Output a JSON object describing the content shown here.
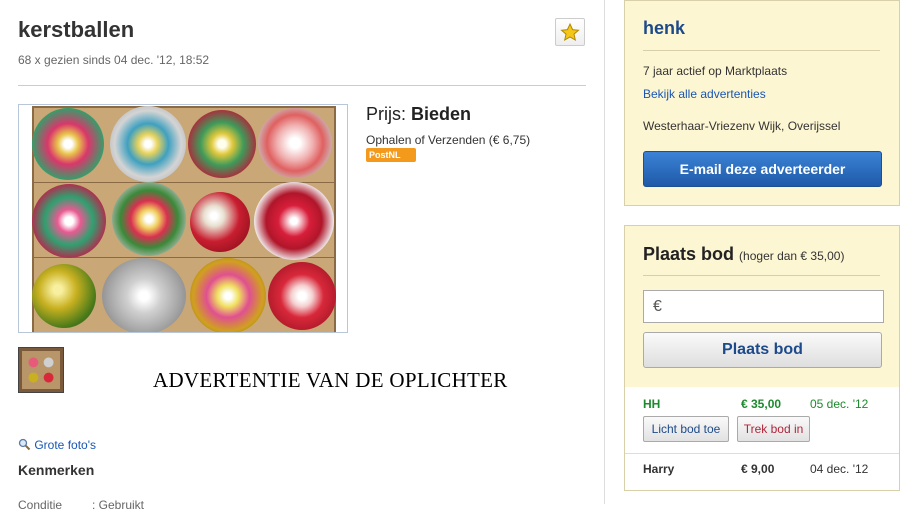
{
  "listing": {
    "title": "kerstballen",
    "views": "68 x gezien sinds 04 dec. '12, 18:52",
    "favorite_icon": "star-icon",
    "price_label": "Prijs:",
    "price_value": "Bieden",
    "shipping": "Ophalen of Verzenden (€ 6,75)",
    "postnl_badge": "PostNL",
    "scam_note": "ADVERTENTIE VAN DE OPLICHTER",
    "big_photos_link": "Grote foto's",
    "big_photos_icon": "magnifier-icon",
    "features_heading": "Kenmerken",
    "condition_label": "Conditie",
    "condition_value": ": Gebruikt"
  },
  "seller": {
    "name": "henk",
    "active_since": "7 jaar actief op Marktplaats",
    "all_ads_link": "Bekijk alle advertenties",
    "location": "Westerhaar-Vriezenv Wijk, Overijssel",
    "email_button": "E-mail deze adverteerder"
  },
  "bidding": {
    "title": "Plaats bod",
    "minimum": "(hoger dan € 35,00)",
    "input_prefix": "€",
    "submit_button": "Plaats bod",
    "bids": [
      {
        "bidder": "HH",
        "amount": "€ 35,00",
        "date": "05 dec. '12",
        "color": "#1d8a2e"
      },
      {
        "bidder": "Harry",
        "amount": "€ 9,00",
        "date": "04 dec. '12",
        "color": "#333333"
      }
    ],
    "light_button": "Licht bod toe",
    "withdraw_button": "Trek bod in"
  }
}
